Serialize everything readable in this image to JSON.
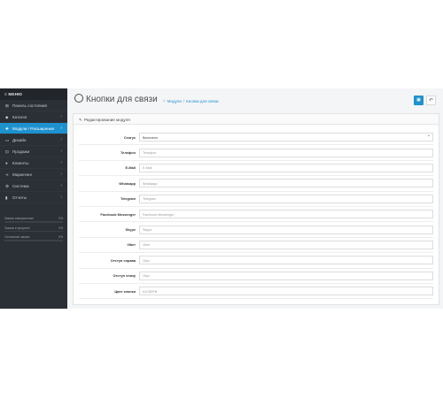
{
  "sidebar": {
    "menu_title": "МЕНЮ",
    "items": [
      {
        "label": "Панель состояния",
        "icon": "dashboard-icon",
        "glyph": "⊞",
        "chev": ""
      },
      {
        "label": "Каталог",
        "icon": "tag-icon",
        "glyph": "◆",
        "chev": "›"
      },
      {
        "label": "Модули / Расширения",
        "icon": "puzzle-icon",
        "glyph": "✚",
        "chev": "›"
      },
      {
        "label": "Дизайн",
        "icon": "monitor-icon",
        "glyph": "▭",
        "chev": "›"
      },
      {
        "label": "Продажи",
        "icon": "cart-icon",
        "glyph": "⊡",
        "chev": "›"
      },
      {
        "label": "Клиенты",
        "icon": "user-icon",
        "glyph": "●",
        "chev": "›"
      },
      {
        "label": "Маркетинг",
        "icon": "share-icon",
        "glyph": "⋖",
        "chev": "›"
      },
      {
        "label": "Система",
        "icon": "gear-icon",
        "glyph": "⚙",
        "chev": "›"
      },
      {
        "label": "Отчеты",
        "icon": "chart-icon",
        "glyph": "▮",
        "chev": "›"
      }
    ],
    "progress": [
      {
        "label": "Заказы завершенные",
        "value": "0%",
        "fraction": 0
      },
      {
        "label": "Заказы в процессе",
        "value": "0%",
        "fraction": 0
      },
      {
        "label": "Остальные заказы",
        "value": "0%",
        "fraction": 0
      }
    ]
  },
  "header": {
    "title": "Кнопки для связи",
    "breadcrumbs": [
      "Модули",
      "Кнопки для связи"
    ],
    "breadcrumb_separator": "/"
  },
  "panel": {
    "title": "Редактирование модуля"
  },
  "form": {
    "status": {
      "label": "Статус",
      "value": "Включено"
    },
    "fields": [
      {
        "label": "Телефон",
        "placeholder": "Телефон"
      },
      {
        "label": "E-Mail",
        "placeholder": "E-Mail"
      },
      {
        "label": "Whatsapp",
        "placeholder": "Whatsapp"
      },
      {
        "label": "Telegram",
        "placeholder": "Telegram"
      },
      {
        "label": "Facebook Messenger",
        "placeholder": "Facebook Messenger"
      },
      {
        "label": "Skype",
        "placeholder": "Skype"
      },
      {
        "label": "Viber",
        "placeholder": "Viber"
      },
      {
        "label": "Отступ справа",
        "placeholder": "10px"
      },
      {
        "label": "Отступ снизу",
        "placeholder": "10px"
      },
      {
        "label": "Цвет кнопки",
        "placeholder": "#1C8DFB"
      }
    ]
  },
  "colors": {
    "accent": "#1e91cf",
    "sidebar_bg": "#2b3037"
  }
}
